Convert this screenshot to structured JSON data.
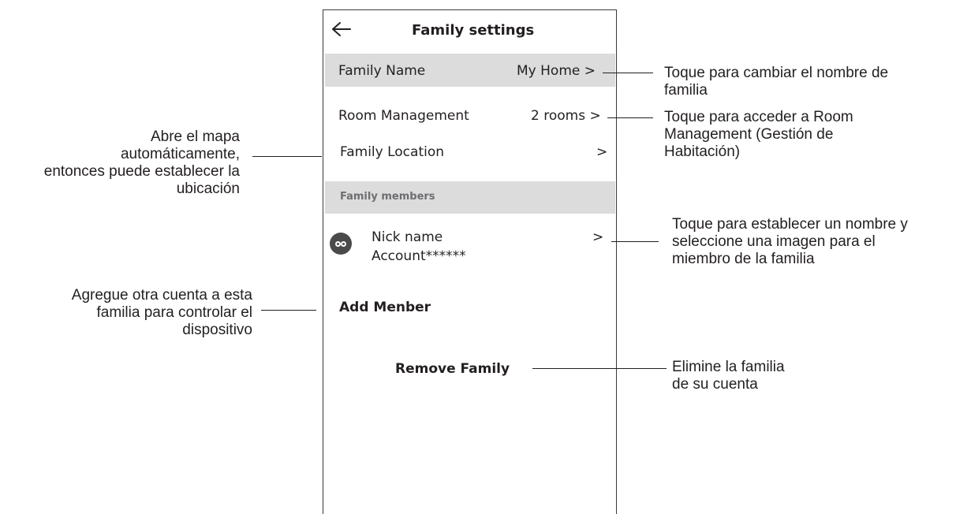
{
  "header": {
    "back_icon": "arrow-left-icon",
    "title": "Family settings"
  },
  "family_name": {
    "label": "Family Name",
    "value": "My Home >"
  },
  "room_management": {
    "label": "Room Management",
    "value": "2 rooms >"
  },
  "family_location": {
    "label": "Family Location",
    "value": ">"
  },
  "family_members_section": {
    "label": "Family members"
  },
  "member": {
    "avatar_icon": "avatar-icon",
    "nick_name": "Nick name",
    "account": "Account******",
    "chevron": ">"
  },
  "add_member": {
    "label": "Add Menber"
  },
  "remove_family": {
    "label": "Remove Family"
  },
  "annotations": {
    "family_name": "Toque para cambiar el nombre de\nfamilia",
    "room_management": "Toque para acceder a Room\nManagement (Gestión de\nHabitación)",
    "family_location": "Abre el mapa\nautomáticamente,\nentonces puede establecer la\nubicación",
    "member": "Toque para establecer un nombre y\nseleccione una imagen para el\nmiembro de la familia",
    "add_member": "Agregue otra cuenta a esta\nfamilia para controlar el\ndispositivo",
    "remove_family": "Elimine la familia\nde su cuenta"
  },
  "colors": {
    "row_highlight": "#dcdcdc",
    "text": "#231f20",
    "section_text": "#6d6e71"
  }
}
